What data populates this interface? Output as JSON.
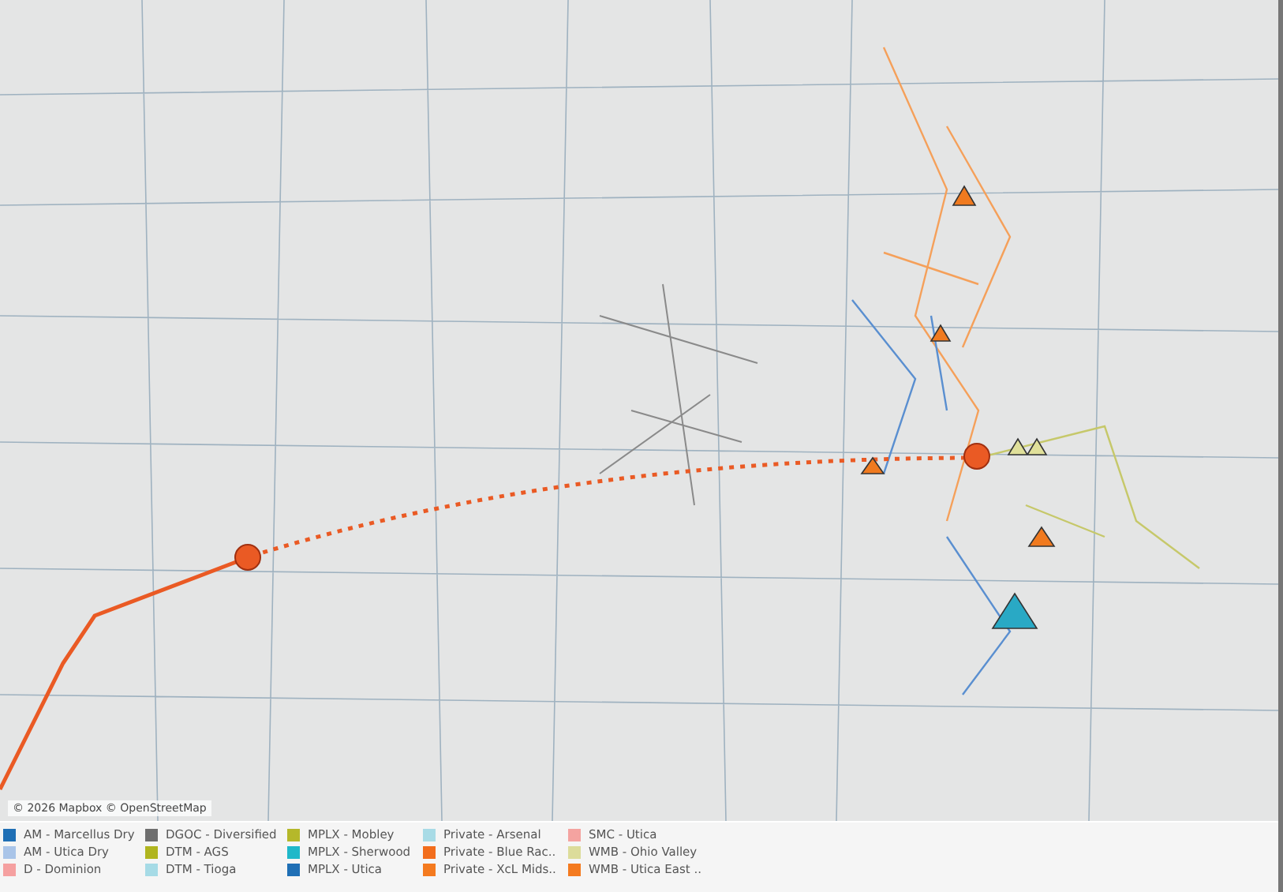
{
  "map": {
    "kind": "picture",
    "attribution": "© 2026 Mapbox © OpenStreetMap"
  },
  "legend": [
    {
      "label": "AM - Marcellus Dry",
      "color": "#1f6fb5"
    },
    {
      "label": "DGOC - Diversified",
      "color": "#6e6e6e"
    },
    {
      "label": "MPLX - Mobley",
      "color": "#b5b82a"
    },
    {
      "label": "Private - Arsenal",
      "color": "#a8dbe6"
    },
    {
      "label": "SMC - Utica",
      "color": "#f4a3a0"
    },
    {
      "label": "AM - Utica Dry",
      "color": "#a9c4e8"
    },
    {
      "label": "DTM - AGS",
      "color": "#b0b51f"
    },
    {
      "label": "MPLX - Sherwood",
      "color": "#1fb8c9"
    },
    {
      "label": "Private - Blue Rac..",
      "color": "#f26d1c"
    },
    {
      "label": "WMB - Ohio Valley",
      "color": "#dcdc9a"
    },
    {
      "label": "D - Dominion",
      "color": "#f5a0a0"
    },
    {
      "label": "DTM - Tioga",
      "color": "#a6dbe6"
    },
    {
      "label": "MPLX - Utica",
      "color": "#1f6fb5"
    },
    {
      "label": "Private - XcL Mids..",
      "color": "#f47a1f"
    },
    {
      "label": "WMB - Utica East ..",
      "color": "#f47a1f"
    }
  ]
}
